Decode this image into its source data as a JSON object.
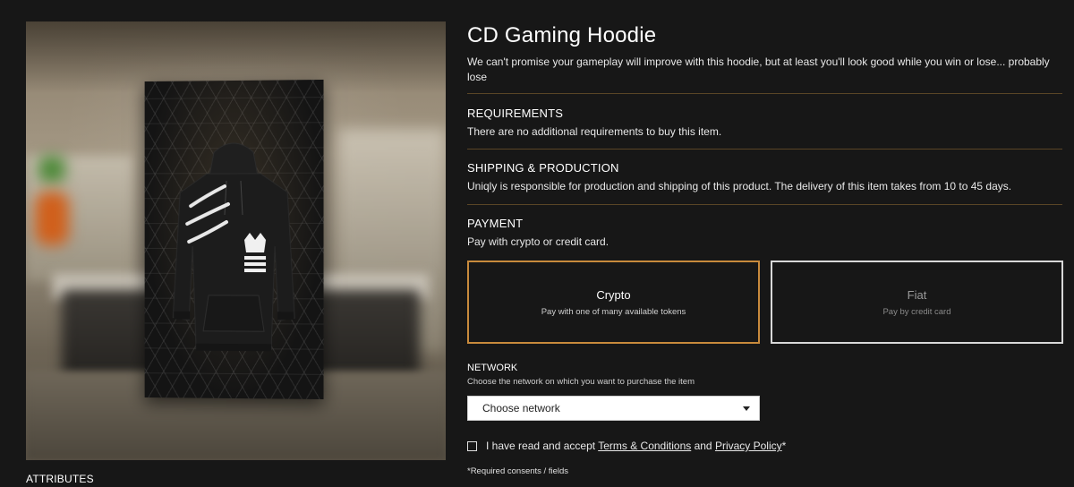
{
  "product": {
    "title": "CD Gaming Hoodie",
    "description": "We can't promise your gameplay will improve with this hoodie, but at least you'll look good while you win or lose... probably lose",
    "image_alt": "hoodie-3d-preview"
  },
  "requirements": {
    "heading": "REQUIREMENTS",
    "text": "There are no additional requirements to buy this item."
  },
  "shipping": {
    "heading": "SHIPPING & PRODUCTION",
    "text": "Uniqly is responsible for production and shipping of this product. The delivery of this item takes from 10 to 45 days."
  },
  "payment": {
    "heading": "PAYMENT",
    "text": "Pay with crypto or credit card.",
    "options": [
      {
        "title": "Crypto",
        "subtitle": "Pay with one of many available tokens",
        "selected": true
      },
      {
        "title": "Fiat",
        "subtitle": "Pay by credit card",
        "selected": false
      }
    ]
  },
  "network": {
    "heading": "NETWORK",
    "subtitle": "Choose the network on which you want to purchase the item",
    "selected_value": "Choose network"
  },
  "consent": {
    "prefix": "I have read and accept ",
    "terms_link": "Terms & Conditions",
    "middle": " and ",
    "privacy_link": "Privacy Policy",
    "suffix": "*",
    "checked": false,
    "required_note": "*Required consents / fields"
  },
  "attributes": {
    "heading": "ATTRIBUTES"
  },
  "colors": {
    "background": "#171717",
    "accent": "#c88a3c",
    "divider": "#5a4526"
  }
}
